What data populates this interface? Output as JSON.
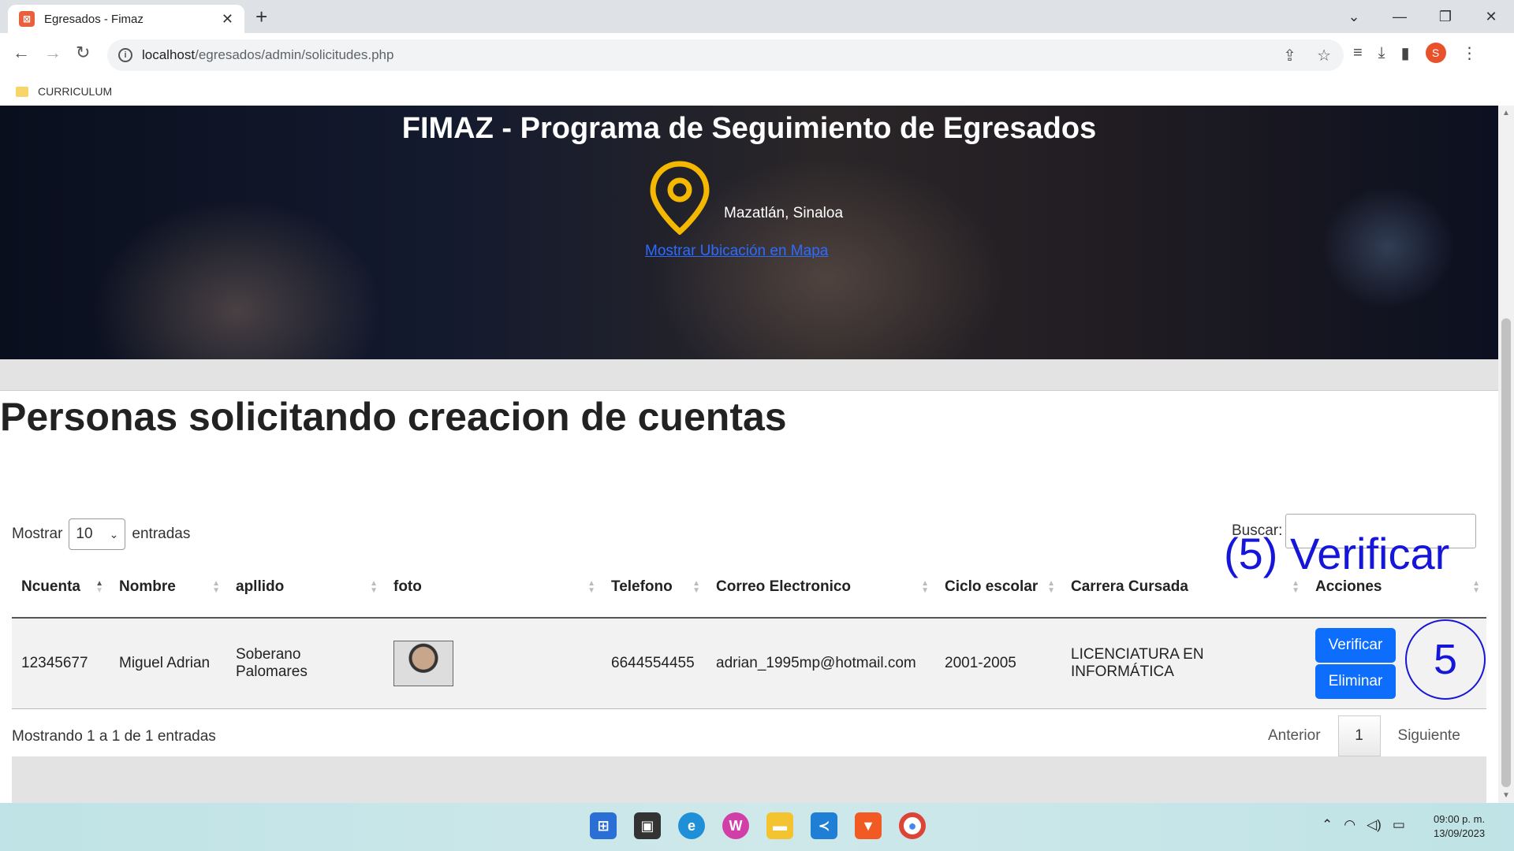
{
  "browser": {
    "tab_title": "Egresados - Fimaz",
    "tab_favicon": "xampp-icon",
    "url_host": "localhost",
    "url_path": "/egresados/admin/solicitudes.php",
    "bookmark": "CURRICULUM",
    "profile_initial": "S"
  },
  "hero": {
    "title": "FIMAZ - Programa de Seguimiento de Egresados",
    "location": "Mazatlán, Sinaloa",
    "map_link": "Mostrar Ubicación en Mapa",
    "pin_color": "#f5b800"
  },
  "page": {
    "heading": "Personas solicitando creacion de cuentas"
  },
  "datatable": {
    "length_label_pre": "Mostrar",
    "length_value": "10",
    "length_label_post": "entradas",
    "search_label": "Buscar:",
    "search_value": "",
    "columns": [
      "Ncuenta",
      "Nombre",
      "apllido",
      "foto",
      "Telefono",
      "Correo Electronico",
      "Ciclo escolar",
      "Carrera Cursada",
      "Acciones"
    ],
    "rows": [
      {
        "ncuenta": "12345677",
        "nombre": "Miguel Adrian",
        "apellido": "Soberano Palomares",
        "telefono": "6644554455",
        "correo": "adrian_1995mp@hotmail.com",
        "ciclo": "2001-2005",
        "carrera": "LICENCIATURA EN INFORMÁTICA",
        "btn_verificar": "Verificar",
        "btn_eliminar": "Eliminar"
      }
    ],
    "info": "Mostrando 1 a 1 de 1 entradas",
    "prev": "Anterior",
    "current_page": "1",
    "next": "Siguiente"
  },
  "annotation": {
    "label": "(5) Verificar",
    "number": "5",
    "color": "#1616d8"
  },
  "taskbar": {
    "time": "09:00 p. m.",
    "date": "13/09/2023"
  }
}
